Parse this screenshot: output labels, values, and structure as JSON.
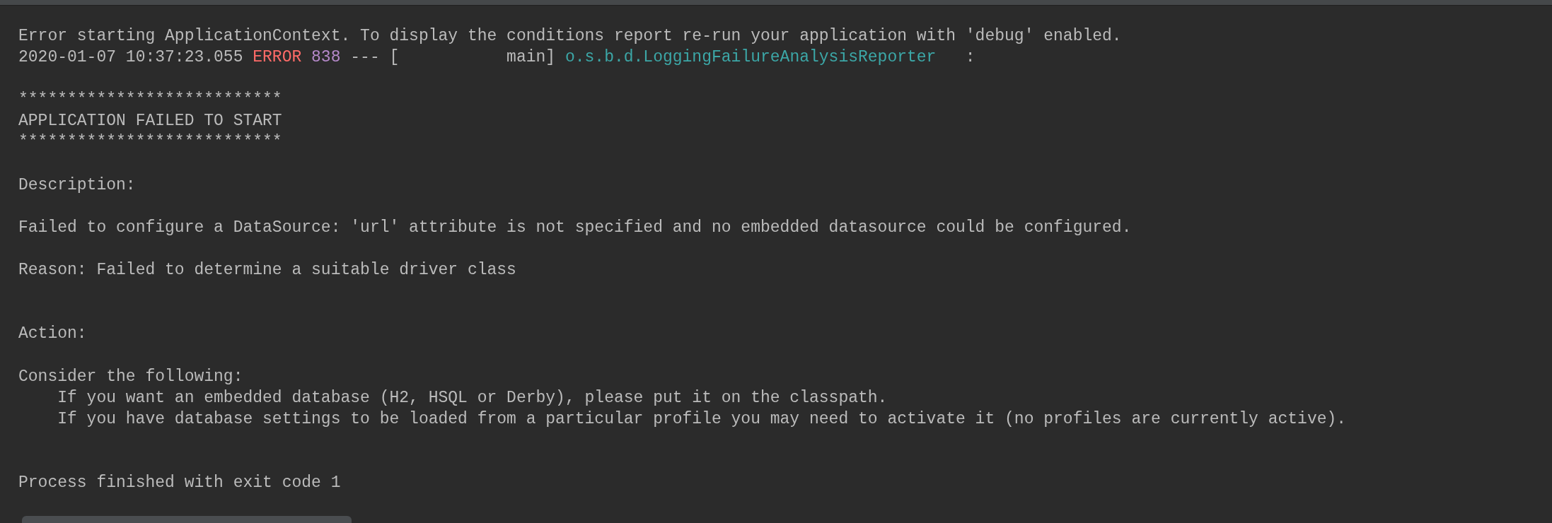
{
  "console": {
    "lines": [
      {
        "kind": "text",
        "text": "Error starting ApplicationContext. To display the conditions report re-run your application with 'debug' enabled."
      },
      {
        "kind": "log",
        "segments": [
          {
            "kind": "timestamp",
            "text": "2020-01-07 10:37:23.055"
          },
          {
            "kind": "level",
            "text": "ERROR"
          },
          {
            "kind": "pid",
            "text": "838"
          },
          {
            "kind": "thread",
            "text": "--- [           main]"
          },
          {
            "kind": "logger",
            "text": "o.s.b.d.LoggingFailureAnalysisReporter"
          },
          {
            "kind": "separator",
            "text": ":"
          }
        ]
      },
      {
        "kind": "blank"
      },
      {
        "kind": "text",
        "text": "***************************"
      },
      {
        "kind": "text",
        "text": "APPLICATION FAILED TO START"
      },
      {
        "kind": "text",
        "text": "***************************"
      },
      {
        "kind": "blank"
      },
      {
        "kind": "text",
        "text": "Description:"
      },
      {
        "kind": "blank"
      },
      {
        "kind": "text",
        "text": "Failed to configure a DataSource: 'url' attribute is not specified and no embedded datasource could be configured."
      },
      {
        "kind": "blank"
      },
      {
        "kind": "text",
        "text": "Reason: Failed to determine a suitable driver class"
      },
      {
        "kind": "blank"
      },
      {
        "kind": "blank"
      },
      {
        "kind": "text",
        "text": "Action:"
      },
      {
        "kind": "blank"
      },
      {
        "kind": "text",
        "text": "Consider the following:"
      },
      {
        "kind": "indented",
        "text": "If you want an embedded database (H2, HSQL or Derby), please put it on the classpath."
      },
      {
        "kind": "indented",
        "text": "If you have database settings to be loaded from a particular profile you may need to activate it (no profiles are currently active)."
      },
      {
        "kind": "blank"
      },
      {
        "kind": "blank"
      },
      {
        "kind": "text",
        "text": "Process finished with exit code 1"
      }
    ]
  }
}
